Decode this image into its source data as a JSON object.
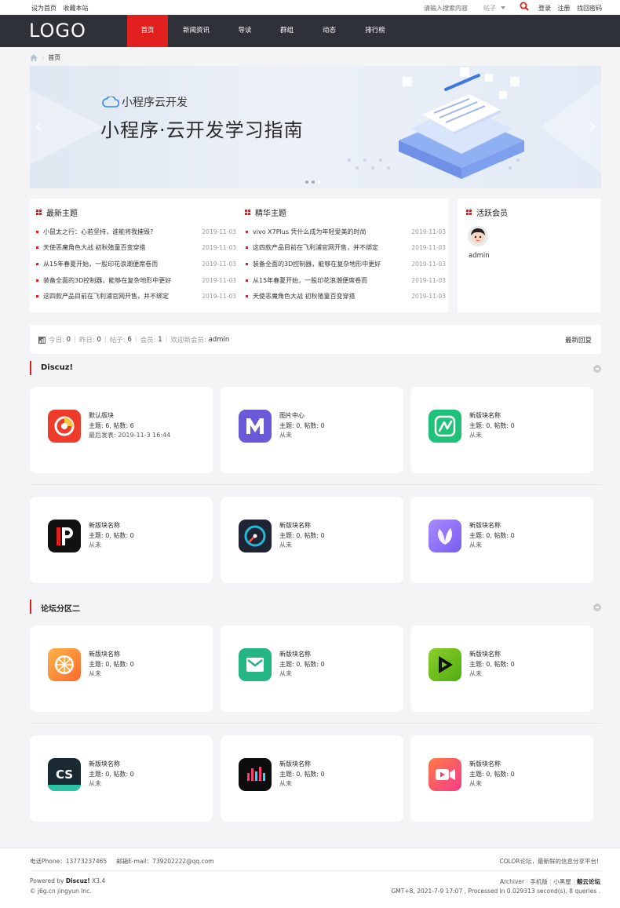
{
  "topbar": {
    "links_left": [
      "设为首页",
      "收藏本站"
    ],
    "search_placeholder": "请输入搜索内容",
    "search_type": "帖子",
    "links_right": [
      "登录",
      "注册",
      "找回密码"
    ]
  },
  "nav": {
    "logo": "LOGO",
    "items": [
      "首页",
      "新闻资讯",
      "导读",
      "群组",
      "动态",
      "排行榜"
    ],
    "active_index": 0
  },
  "breadcrumb": {
    "home": "首页"
  },
  "banner": {
    "subtitle": "小程序云开发",
    "title": "小程序·云开发学习指南",
    "slides": 3,
    "active_slide": 2
  },
  "latest": {
    "title": "最新主题",
    "items": [
      {
        "title": "小鼠太之行：心若坚持，谁能将我摧毁?",
        "date": "2019-11-03"
      },
      {
        "title": "天使恶魔角色大战 初秋殖童百变穿搭",
        "date": "2019-11-03"
      },
      {
        "title": "从15年春夏开始，一股印花浪潮便席卷而",
        "date": "2019-11-03"
      },
      {
        "title": "装备全面的3D控制器，能够在复杂地形中更好",
        "date": "2019-11-03"
      },
      {
        "title": "这四款产品目前在飞利浦官网开售，并不绑定",
        "date": "2019-11-03"
      }
    ]
  },
  "featured": {
    "title": "精华主题",
    "items": [
      {
        "title": "vivo X7Plus 凭什么成为年轻爱美的时尚",
        "date": "2019-11-03"
      },
      {
        "title": "这四款产品目前在飞利浦官网开售，并不绑定",
        "date": "2019-11-03"
      },
      {
        "title": "装备全面的3D控制器，能够在复杂地形中更好",
        "date": "2019-11-03"
      },
      {
        "title": "从15年春夏开始，一股印花浪潮便席卷而",
        "date": "2019-11-03"
      },
      {
        "title": "天使恶魔角色大战 初秋殖童百变穿搭",
        "date": "2019-11-03"
      }
    ]
  },
  "members": {
    "title": "活跃会员",
    "items": [
      {
        "name": "admin"
      }
    ]
  },
  "stats": {
    "today_label": "今日:",
    "today": "0",
    "yesterday_label": "昨日:",
    "yesterday": "0",
    "posts_label": "帖子:",
    "posts": "6",
    "members_label": "会员:",
    "members": "1",
    "welcome_label": "欢迎新会员:",
    "newest": "admin",
    "latest_reply": "最新回复"
  },
  "sections": [
    {
      "title": "Discuz!",
      "forums": [
        {
          "name": "默认版块",
          "meta": "主题: 6, 帖数: 6",
          "last": "最后发表: 2019-11-3 16:44",
          "icon": "pie-icon",
          "color": "#ee3b2c"
        },
        {
          "name": "图片中心",
          "meta": "主题: 0, 帖数: 0",
          "last": "从未",
          "icon": "m-icon",
          "color": "#6a5ad8"
        },
        {
          "name": "新版块名称",
          "meta": "主题: 0, 帖数: 0",
          "last": "从未",
          "icon": "wave-icon",
          "color": "#20c27a"
        },
        {
          "name": "新版块名称",
          "meta": "主题: 0, 帖数: 0",
          "last": "从未",
          "icon": "p-icon",
          "color": "#111111"
        },
        {
          "name": "新版块名称",
          "meta": "主题: 0, 帖数: 0",
          "last": "从未",
          "icon": "gauge-icon",
          "color": "#1e2433"
        },
        {
          "name": "新版块名称",
          "meta": "主题: 0, 帖数: 0",
          "last": "从未",
          "icon": "leaf-icon",
          "color": "#8a6cf0"
        }
      ]
    },
    {
      "title": "论坛分区二",
      "forums": [
        {
          "name": "新版块名称",
          "meta": "主题: 0, 帖数: 0",
          "last": "从未",
          "icon": "orange-icon",
          "color": "#fb8a2e"
        },
        {
          "name": "新版块名称",
          "meta": "主题: 0, 帖数: 0",
          "last": "从未",
          "icon": "mail-icon",
          "color": "#25b584"
        },
        {
          "name": "新版块名称",
          "meta": "主题: 0, 帖数: 0",
          "last": "从未",
          "icon": "play-icon",
          "color": "#6cbf1e"
        },
        {
          "name": "新版块名称",
          "meta": "主题: 0, 帖数: 0",
          "last": "从未",
          "icon": "cs-icon",
          "color": "#1a2a33"
        },
        {
          "name": "新版块名称",
          "meta": "主题: 0, 帖数: 0",
          "last": "从未",
          "icon": "audio-icon",
          "color": "#0d0d0d"
        },
        {
          "name": "新版块名称",
          "meta": "主题: 0, 帖数: 0",
          "last": "从未",
          "icon": "camera-icon",
          "color": "#f5456a"
        }
      ]
    }
  ],
  "footer": {
    "phone": "电话Phone：13773237465",
    "email": "邮箱E-mail：739202222@qq.com",
    "slogan": "COLOR论坛，最新鲜的信息分享平台!",
    "powered_prefix": "Powered by ",
    "powered_brand": "Discuz!",
    "powered_version": " X3.4",
    "copyright": "© j6g.cn jingyun Inc.",
    "links": [
      "Archiver",
      "手机版",
      "小黑屋",
      "鲸云论坛"
    ],
    "runtime": "GMT+8, 2021-7-9 17:07 , Processed in 0.029313 second(s), 8 queries ."
  }
}
